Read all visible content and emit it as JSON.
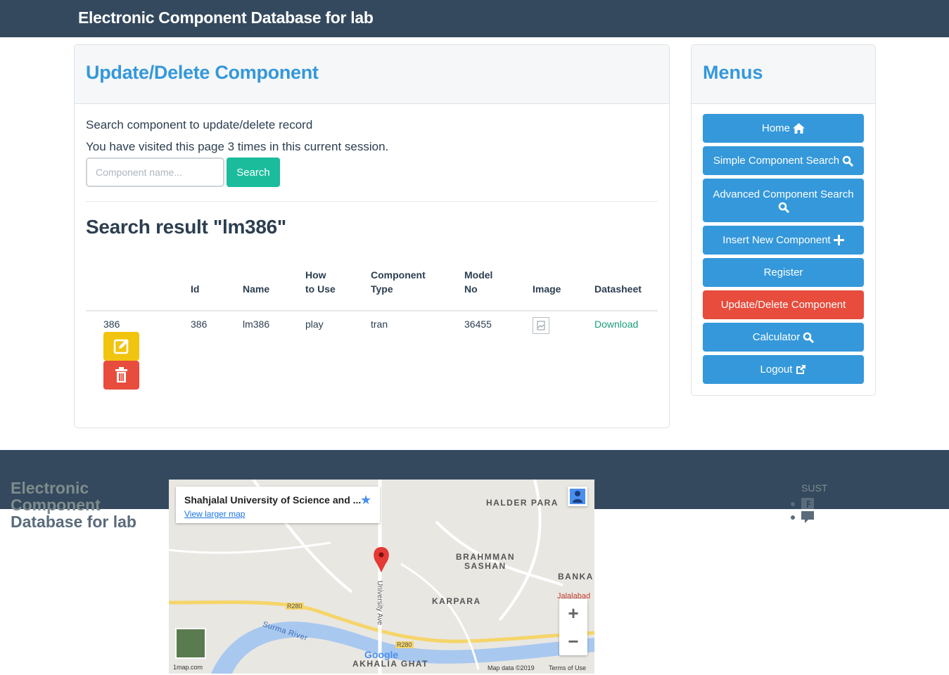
{
  "header": {
    "brand": "Electronic Component Database for lab"
  },
  "main": {
    "title": "Update/Delete Component",
    "intro": "Search component to update/delete record",
    "visits": "You have visited this page 3 times in this current session.",
    "search": {
      "placeholder": "Component name...",
      "button_label": "Search"
    },
    "result_title": "Search result \"lm386\"",
    "table": {
      "headers": [
        {
          "line1": "Id",
          "line2": ""
        },
        {
          "line1": "Name",
          "line2": ""
        },
        {
          "line1": "How",
          "line2": "to Use"
        },
        {
          "line1": "Component",
          "line2": "Type"
        },
        {
          "line1": "Model",
          "line2": "No"
        },
        {
          "line1": "Image",
          "line2": ""
        },
        {
          "line1": "Datasheet",
          "line2": ""
        }
      ],
      "rows": [
        {
          "row_id": "386",
          "id": "386",
          "name": "lm386",
          "how_to_use": "play",
          "type": "tran",
          "model_no": "36455",
          "datasheet": "Download"
        }
      ]
    }
  },
  "menu": {
    "title": "Menus",
    "items": [
      {
        "label": "Home",
        "icon": "home-icon"
      },
      {
        "label": "Simple Component Search",
        "icon": "search-icon"
      },
      {
        "label": "Advanced Component Search",
        "icon": "search-icon"
      },
      {
        "label": "Insert New Component",
        "icon": "plus-icon"
      },
      {
        "label": "Register",
        "icon": ""
      },
      {
        "label": "Update/Delete Component",
        "icon": "",
        "active": true
      },
      {
        "label": "Calculator",
        "icon": "search-icon"
      },
      {
        "label": "Logout",
        "icon": "external-link-icon"
      }
    ]
  },
  "footer": {
    "title_line1": "Electronic",
    "title_line2": "Component",
    "title_line3": "Database for lab",
    "org": "SUST",
    "map": {
      "place_title": "Shahjalal University of Science and ...",
      "larger_map": "View larger map",
      "labels": [
        "HALDER PARA",
        "BRAHMMAN",
        "SASHAN",
        "BANKA",
        "KARPARA",
        "AKHALIA GHAT",
        "Surma River",
        "University Ave",
        "Jalalabad",
        "R280",
        "R280"
      ],
      "logo": "Google",
      "attribution": "Map data ©2019",
      "terms": "Terms of Use",
      "credit": "1map.com"
    }
  },
  "colors": {
    "header_bg": "#34495e",
    "accent_blue": "#3498db",
    "success": "#1abc9c",
    "danger": "#e74c3c",
    "warning": "#f1c40f"
  }
}
